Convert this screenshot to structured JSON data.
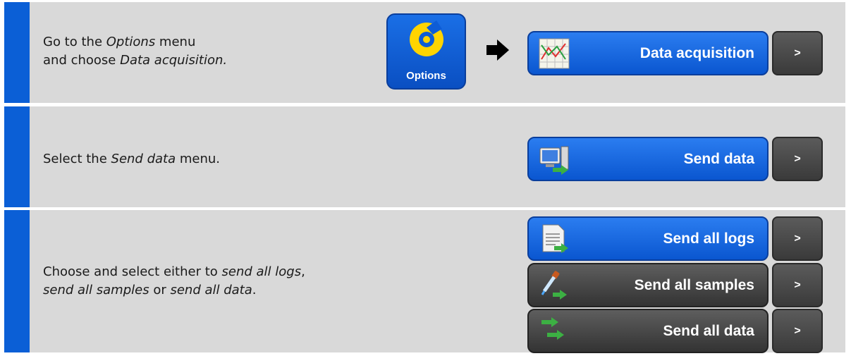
{
  "steps": [
    {
      "line1": {
        "a": "Go to the ",
        "b": "Options",
        "c": " menu"
      },
      "line2": {
        "a": "and choose ",
        "b": "Data acquisition."
      }
    },
    {
      "line1": {
        "a": "Select the ",
        "b": "Send data",
        "c": " menu."
      }
    },
    {
      "line1": {
        "a": "Choose and select either to ",
        "b": "send all logs",
        "c": ","
      },
      "line2": {
        "a": "send all samples",
        "b": " or ",
        "c": "send all data",
        "d": "."
      }
    }
  ],
  "options_icon": {
    "label": "Options",
    "color": "#ffd400"
  },
  "buttons": {
    "data_acquisition": "Data acquisition",
    "send_data": "Send data",
    "send_all_logs": "Send all logs",
    "send_all_samples": "Send all samples",
    "send_all_data": "Send all data",
    "chevron": ">"
  },
  "colors": {
    "accent_bar": "#0b5fd6",
    "panel": "#d9d9d9",
    "selected_button": "#0a56d0",
    "unselected_button": "#3a3a3a"
  }
}
